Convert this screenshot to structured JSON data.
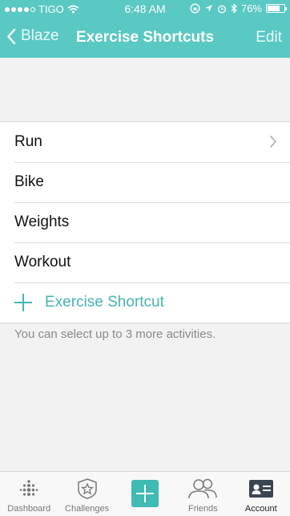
{
  "status": {
    "carrier": "TIGO",
    "time": "6:48 AM",
    "battery": "76%",
    "battery_level": 0.76
  },
  "nav": {
    "back_label": "Blaze",
    "title": "Exercise Shortcuts",
    "edit_label": "Edit"
  },
  "shortcuts": [
    {
      "label": "Run"
    },
    {
      "label": "Bike"
    },
    {
      "label": "Weights"
    },
    {
      "label": "Workout"
    }
  ],
  "add_label": "Exercise Shortcut",
  "hint": "You can select up to 3 more activities.",
  "tabs": [
    {
      "label": "Dashboard",
      "icon": "dashboard-dots-icon"
    },
    {
      "label": "Challenges",
      "icon": "star-badge-icon"
    },
    {
      "label": "",
      "icon": "plus-icon"
    },
    {
      "label": "Friends",
      "icon": "friends-icon"
    },
    {
      "label": "Account",
      "icon": "account-card-icon"
    }
  ],
  "colors": {
    "header": "#5ac8c3",
    "accent": "#47b5b1",
    "center_button": "#3fbab4"
  }
}
